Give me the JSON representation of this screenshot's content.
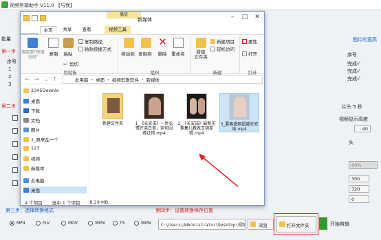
{
  "app": {
    "title": "视频剪辑助手 V11.0 【与我】",
    "left_labels": [
      "批量",
      "第一步",
      "序号",
      "1",
      "2",
      "3",
      "第二步"
    ],
    "right_labels": [
      "图片的宽高",
      "序号",
      "完成√",
      "完成√",
      "完成√",
      "片头 5 秒",
      "视频显示高度",
      "40",
      "头",
      "60%",
      "300",
      "720",
      "0"
    ],
    "step3_label": "第三步：选择转换格式",
    "step4_label": "第四步：设置转换保存位置",
    "formats": [
      "MP4",
      "FLV",
      "MOV",
      "WMV",
      "TS",
      "WMV"
    ],
    "selected_format": "MP4",
    "save_path": "C:\\Users\\Administrator\\Desktop\\视频剪辑",
    "browse_label": "浏览",
    "open_folder_label": "打开文件夹",
    "start_label": "开始剪辑"
  },
  "explorer": {
    "ctx_tab": "播放",
    "window_title": "新媒体",
    "tabs": [
      "文件",
      "主页",
      "共享",
      "查看",
      "视频工具"
    ],
    "ribbon": {
      "clipboard": {
        "pin": "固定到\"快速访问\"",
        "copy": "复制",
        "paste": "粘贴",
        "copy_path": "复制路径",
        "paste_shortcut": "粘贴快捷方式",
        "cut": "剪切",
        "group": "剪贴板"
      },
      "organize": {
        "move_to": "移动到",
        "copy_to": "复制到",
        "delete": "删除",
        "rename": "重命名",
        "group": "组织"
      },
      "new": {
        "new_folder": "新建\n文件夹",
        "new_item": "新建项目",
        "easy_access": "轻松访问",
        "group": "新建"
      },
      "open": {
        "properties": "属性",
        "open": "打开",
        "group": "打开"
      },
      "select": {
        "select_all": "全部选择",
        "select_none": "全部取消",
        "invert": "反向选择",
        "group": "选择"
      }
    },
    "address": [
      "此电脑",
      "桌面",
      "视频剪辑软件",
      "新媒体"
    ],
    "nav": [
      {
        "label": "2345Downlo",
        "color": "#f2c14e"
      },
      {
        "label": "桌面",
        "color": "#3c7fd6"
      },
      {
        "label": "下载",
        "color": "#2d6bc4"
      },
      {
        "label": "文档",
        "color": "#8a8a8a"
      },
      {
        "label": "图片",
        "color": "#5c8fd8"
      },
      {
        "label": "1_原来在一个",
        "color": "#f2c14e"
      },
      {
        "label": "123",
        "color": "#f2c14e"
      },
      {
        "label": "视频",
        "color": "#f2c14e"
      },
      {
        "label": "新媒体",
        "color": "#f2c14e"
      },
      {
        "label": "此电脑",
        "color": "#4a90d9"
      },
      {
        "label": "桌面",
        "color": "#3c7fd6"
      }
    ],
    "files": [
      {
        "name": "新建文件夹",
        "kind": "folder"
      },
      {
        "name": "1_《长安诺》一世长情许诺白首，奈何因缘过错.mp4",
        "kind": "video"
      },
      {
        "name": "2_《长安诺》最新花絮集儿教表玉玥拿唱.mp4",
        "kind": "video"
      },
      {
        "name": "3_要客盛颜超越长安诺.mp4",
        "kind": "video"
      }
    ],
    "status": [
      "4 个项目",
      "选中 1 个项目",
      "8.29 MB"
    ]
  }
}
